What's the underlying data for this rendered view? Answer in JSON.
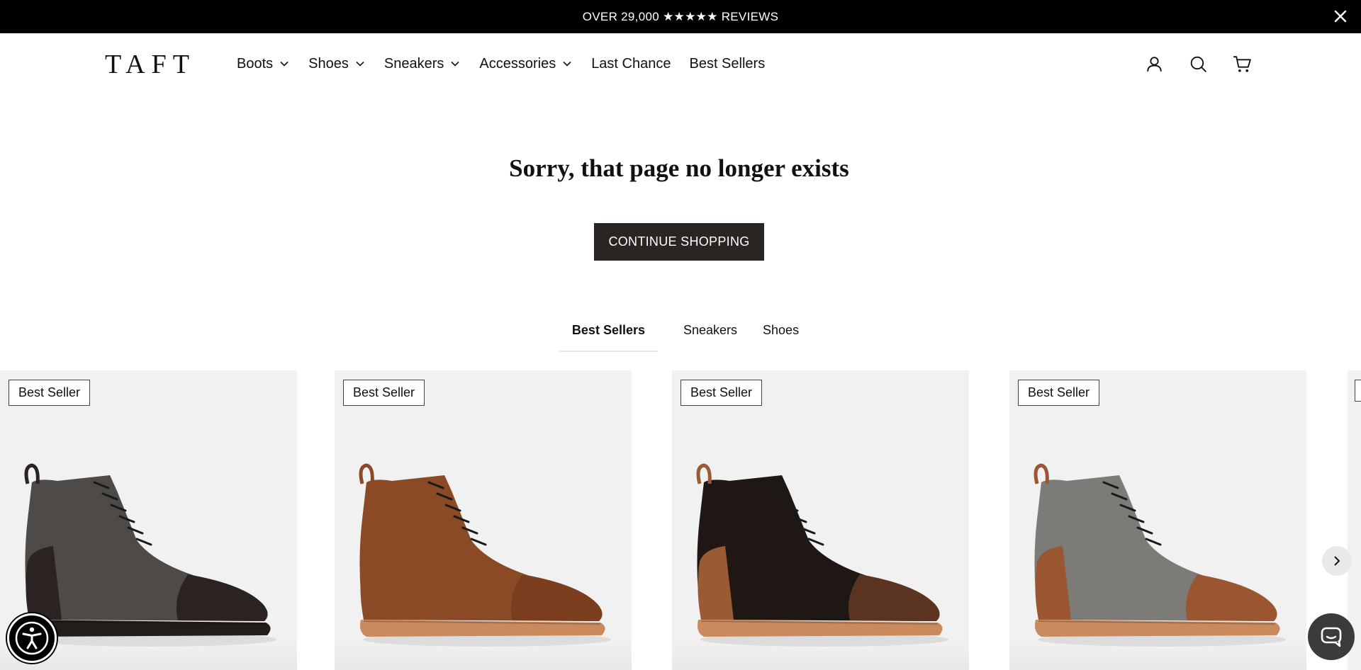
{
  "announcement": {
    "text": "OVER 29,000 ★★★★★ REVIEWS"
  },
  "header": {
    "logo": "TAFT",
    "nav": [
      {
        "label": "Boots",
        "dropdown": true
      },
      {
        "label": "Shoes",
        "dropdown": true
      },
      {
        "label": "Sneakers",
        "dropdown": true
      },
      {
        "label": "Accessories",
        "dropdown": true
      },
      {
        "label": "Last Chance",
        "dropdown": false
      },
      {
        "label": "Best Sellers",
        "dropdown": false
      }
    ],
    "icons": [
      "account-icon",
      "search-icon",
      "cart-icon"
    ]
  },
  "main": {
    "title": "Sorry, that page no longer exists",
    "cta": "CONTINUE SHOPPING",
    "tabs": [
      {
        "label": "Best Sellers",
        "active": true
      },
      {
        "label": "Sneakers",
        "active": false
      },
      {
        "label": "Shoes",
        "active": false
      }
    ]
  },
  "products": [
    {
      "badge": "Best Seller",
      "upper": "#4d4a47",
      "toe": "#2b2321",
      "heel": "#2b2321",
      "sole": "#221c1a"
    },
    {
      "badge": "Best Seller",
      "upper": "#8a4a26",
      "toe": "#7a3e1e",
      "heel": "#8a4a26",
      "sole": "#c98a5e"
    },
    {
      "badge": "Best Seller",
      "upper": "#1e1714",
      "toe": "#5a3420",
      "heel": "#9a5a34",
      "sole": "#c98a5e"
    },
    {
      "badge": "Best Seller",
      "upper": "#7d7b78",
      "toe": "#9a5630",
      "heel": "#9a5630",
      "sole": "#c98a5e"
    }
  ],
  "colors": {
    "announcement_bg": "#000000",
    "cta_bg": "#2a2423",
    "card_bg": "#f1f1f1"
  }
}
